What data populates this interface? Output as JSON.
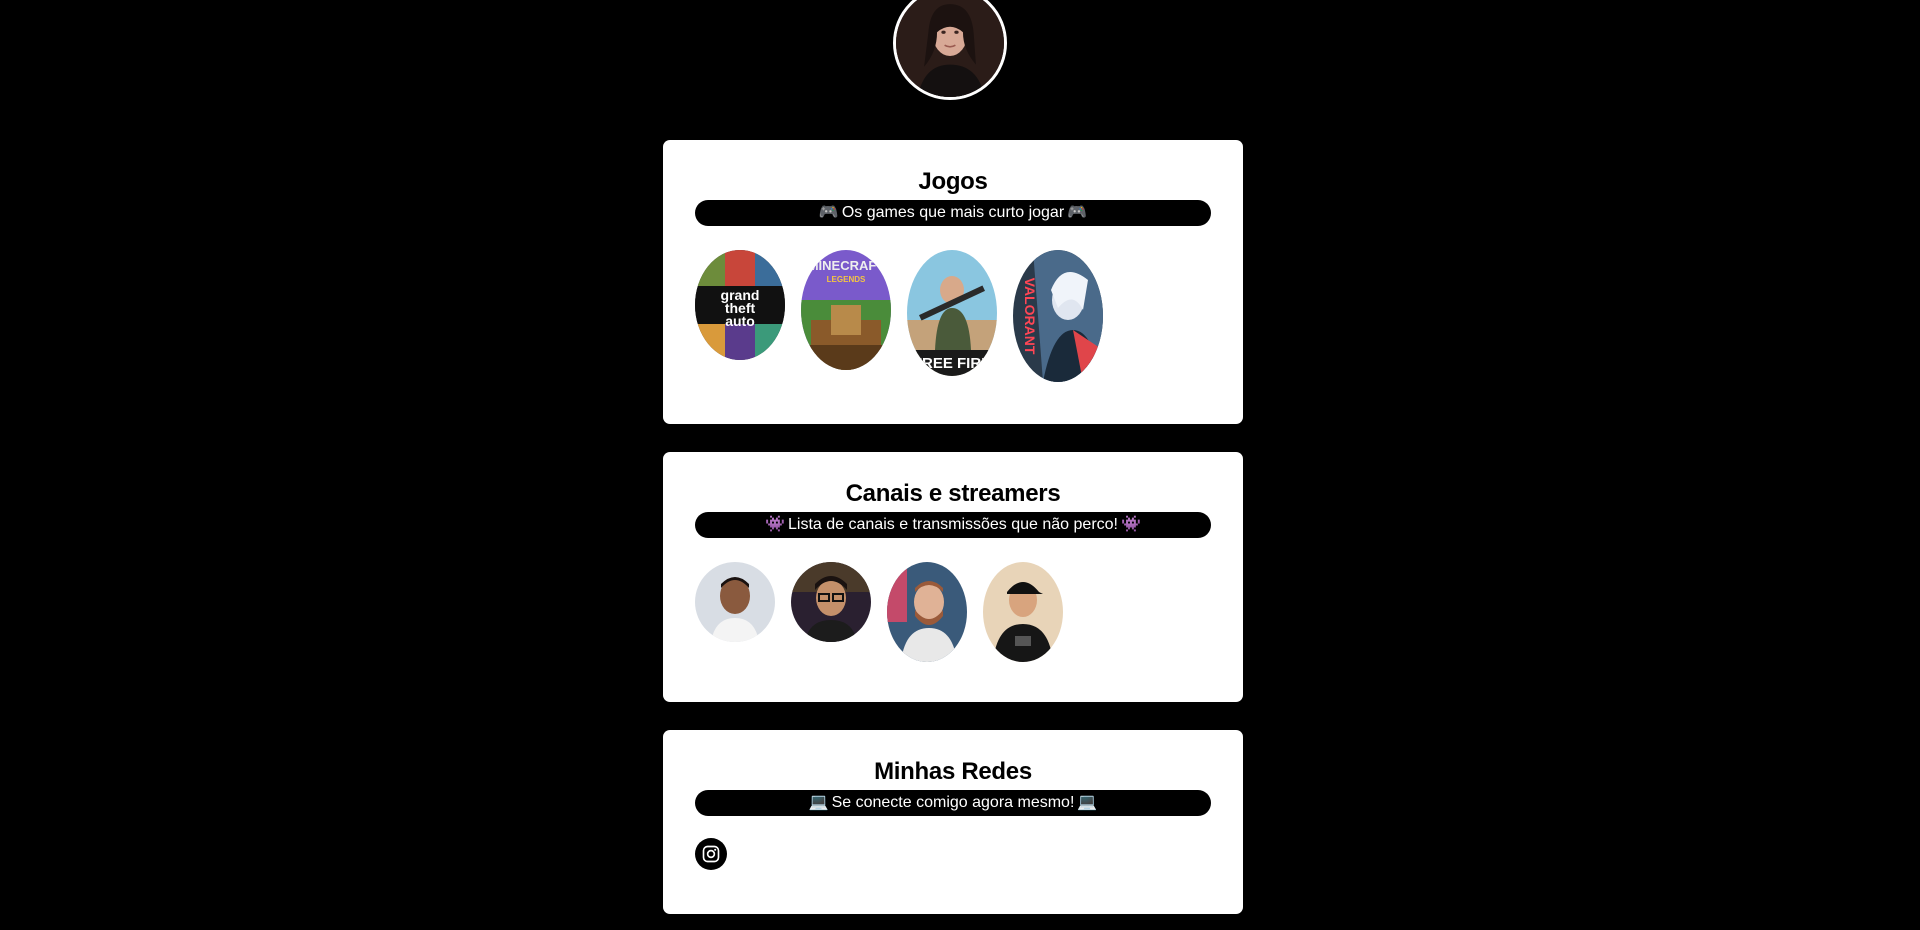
{
  "profile": {
    "avatar_icon": "profile-photo"
  },
  "games": {
    "title": "Jogos",
    "subtitle": "Os games que mais curto jogar",
    "subtitle_emoji": "🎮",
    "items": [
      {
        "name": "GTA V",
        "text": "grand theft auto V"
      },
      {
        "name": "Minecraft",
        "text": "MINECRAFT"
      },
      {
        "name": "Free Fire",
        "text": "FREE FIRE"
      },
      {
        "name": "Valorant",
        "text": "VALORANT"
      }
    ]
  },
  "streamers": {
    "title": "Canais e streamers",
    "subtitle": "Lista de canais e transmissões que não perco!",
    "subtitle_emoji": "👾"
  },
  "networks": {
    "title": "Minhas Redes",
    "subtitle": "Se conecte comigo agora mesmo!",
    "subtitle_emoji": "💻",
    "links": [
      {
        "icon": "instagram-icon"
      }
    ]
  }
}
